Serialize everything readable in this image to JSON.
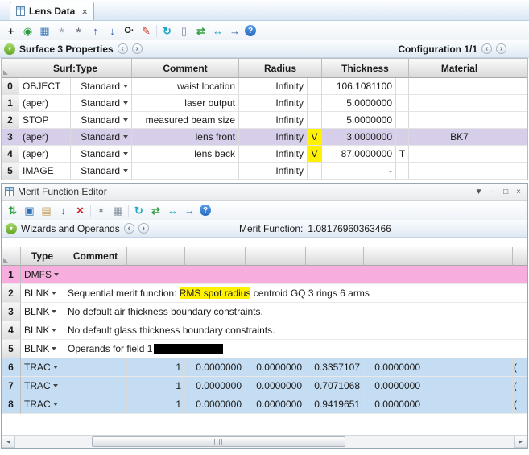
{
  "colors": {
    "highlight_yellow": "#fff100",
    "selected_row": "#d7cfe9",
    "dmfs_row_pink": "#f7aede",
    "trac_row_blue": "#c5ddf2"
  },
  "tab": {
    "label": "Lens Data",
    "close": "×"
  },
  "toolbars": {
    "lde_icons": [
      "insert-surface",
      "globe",
      "image",
      "tilt-decenter-a",
      "tilt-decenter-b",
      "move-up",
      "move-down",
      "aperture-marker",
      "draw-pencil",
      "reload",
      "report",
      "sync",
      "swap",
      "go-forward",
      "help"
    ],
    "mfe_icons": [
      "update",
      "save",
      "load",
      "insert-below",
      "delete",
      "tools",
      "grid",
      "reload",
      "sync",
      "swap",
      "go-forward",
      "help"
    ]
  },
  "surface_panel": {
    "title": "Surface 3 Properties",
    "configuration": "Configuration 1/1"
  },
  "lde": {
    "headers": {
      "surf_type": "Surf:Type",
      "comment": "Comment",
      "radius": "Radius",
      "thickness": "Thickness",
      "material": "Material"
    },
    "rows": [
      {
        "num": "0",
        "name": "OBJECT",
        "type": "Standard",
        "comment": "waist location",
        "radius": "Infinity",
        "radius_flag": "",
        "thickness": "106.1081100",
        "thickness_flag": "",
        "material": ""
      },
      {
        "num": "1",
        "name": "(aper)",
        "type": "Standard",
        "comment": "laser output",
        "radius": "Infinity",
        "radius_flag": "",
        "thickness": "5.0000000",
        "thickness_flag": "",
        "material": ""
      },
      {
        "num": "2",
        "name": "STOP",
        "type": "Standard",
        "comment": "measured beam size",
        "radius": "Infinity",
        "radius_flag": "",
        "thickness": "5.0000000",
        "thickness_flag": "",
        "material": ""
      },
      {
        "num": "3",
        "name": "(aper)",
        "type": "Standard",
        "comment": "lens front",
        "radius": "Infinity",
        "radius_flag": "V",
        "thickness": "3.0000000",
        "thickness_flag": "",
        "material": "BK7"
      },
      {
        "num": "4",
        "name": "(aper)",
        "type": "Standard",
        "comment": "lens back",
        "radius": "Infinity",
        "radius_flag": "V",
        "thickness": "87.0000000",
        "thickness_flag": "T",
        "material": ""
      },
      {
        "num": "5",
        "name": "IMAGE",
        "type": "Standard",
        "comment": "",
        "radius": "Infinity",
        "radius_flag": "",
        "thickness": "-",
        "thickness_flag": "",
        "material": ""
      }
    ]
  },
  "mfe": {
    "window_title": "Merit Function Editor",
    "window_controls": [
      "▼",
      "–",
      "□",
      "×"
    ],
    "panel_title": "Wizards and Operands",
    "merit_label": "Merit Function:",
    "merit_value": "1.08176960363466",
    "headers": {
      "type": "Type",
      "comment": "Comment"
    },
    "rows": [
      {
        "num": "1",
        "type": "DMFS"
      },
      {
        "num": "2",
        "type": "BLNK",
        "comment_pre": "Sequential merit function: ",
        "comment_highlight": "RMS spot radius",
        "comment_post": " centroid GQ 3 rings 6 arms"
      },
      {
        "num": "3",
        "type": "BLNK",
        "comment": "No default air thickness boundary constraints."
      },
      {
        "num": "4",
        "type": "BLNK",
        "comment": "No default glass thickness boundary constraints."
      },
      {
        "num": "5",
        "type": "BLNK",
        "comment": "Operands for field 1"
      },
      {
        "num": "6",
        "type": "TRAC",
        "values": [
          "1",
          "0.0000000",
          "0.0000000",
          "0.3357107",
          "0.0000000"
        ],
        "clipped": "("
      },
      {
        "num": "7",
        "type": "TRAC",
        "values": [
          "1",
          "0.0000000",
          "0.0000000",
          "0.7071068",
          "0.0000000"
        ],
        "clipped": "("
      },
      {
        "num": "8",
        "type": "TRAC",
        "values": [
          "1",
          "0.0000000",
          "0.0000000",
          "0.9419651",
          "0.0000000"
        ],
        "clipped": "("
      }
    ]
  }
}
